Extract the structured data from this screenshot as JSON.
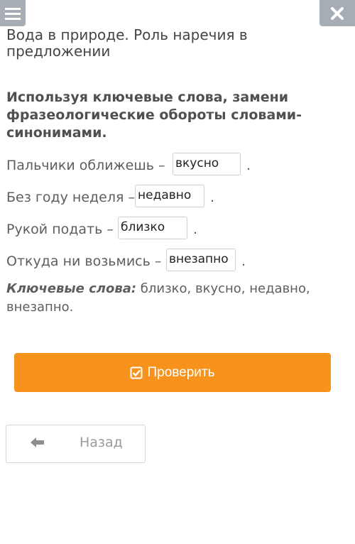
{
  "header": {
    "menu_icon": "hamburger-icon",
    "close_icon": "close-icon"
  },
  "lesson_title": "Вода в природе. Роль наречия в предложении",
  "instruction": "Используя ключевые слова, замени фразеологические обороты словами-синонимами.",
  "sentences": [
    {
      "prefix": "Пальчики оближешь –",
      "answer": "вкусно",
      "suffix": "."
    },
    {
      "prefix": "Без году неделя –",
      "answer": "недавно",
      "suffix": "."
    },
    {
      "prefix": "Рукой подать –",
      "answer": "близко",
      "suffix": "."
    },
    {
      "prefix": "Откуда ни возьмись –",
      "answer": "внезапно",
      "suffix": "."
    }
  ],
  "keywords": {
    "label": "Ключевые слова:",
    "text": "близко, вкусно, недавно, внезапно."
  },
  "check_button": {
    "label": "Проверить",
    "icon": "check-square-icon"
  },
  "back_button": {
    "label": "Назад",
    "icon": "arrow-left-icon"
  },
  "colors": {
    "accent": "#f7931d",
    "top_button": "#a7adb4"
  }
}
